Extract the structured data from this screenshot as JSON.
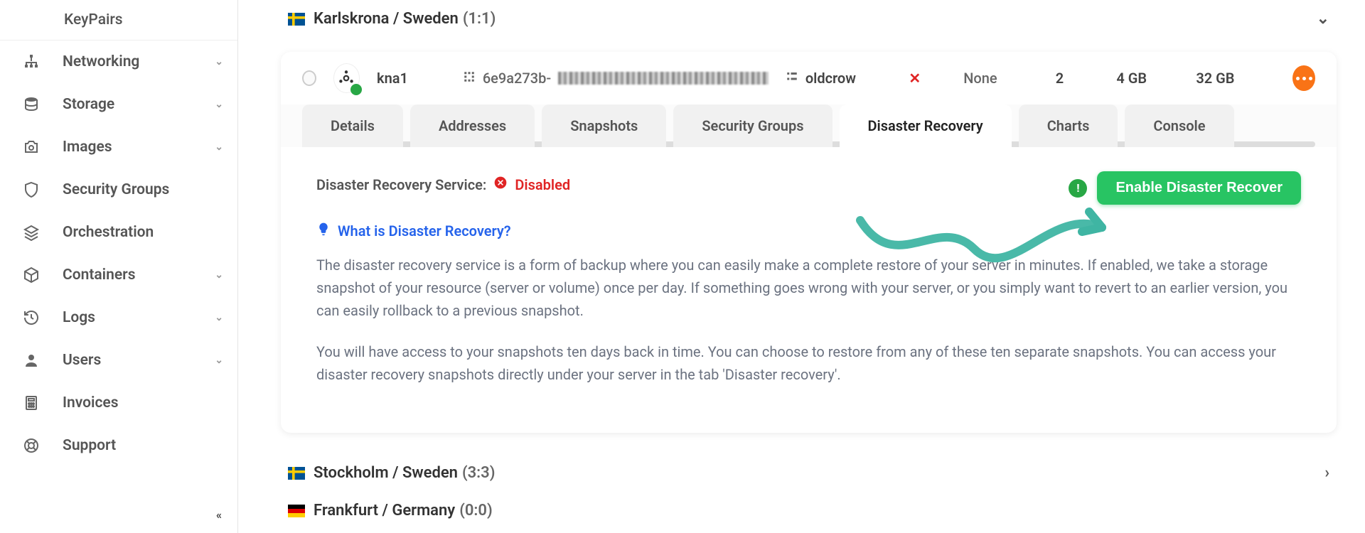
{
  "sidebar": {
    "items": [
      {
        "label": "KeyPairs",
        "chev": false,
        "sub": true
      },
      {
        "label": "Networking",
        "chev": true
      },
      {
        "label": "Storage",
        "chev": true
      },
      {
        "label": "Images",
        "chev": true
      },
      {
        "label": "Security Groups",
        "chev": false
      },
      {
        "label": "Orchestration",
        "chev": false
      },
      {
        "label": "Containers",
        "chev": true
      },
      {
        "label": "Logs",
        "chev": true
      },
      {
        "label": "Users",
        "chev": true
      },
      {
        "label": "Invoices",
        "chev": false
      },
      {
        "label": "Support",
        "chev": false
      }
    ]
  },
  "regions": {
    "r1": {
      "name": "Karlskrona / Sweden",
      "count": "(1:1)"
    },
    "r2": {
      "name": "Stockholm / Sweden",
      "count": "(3:3)"
    },
    "r3": {
      "name": "Frankfurt / Germany",
      "count": "(0:0)"
    }
  },
  "instance": {
    "name": "kna1",
    "uuid_prefix": "6e9a273b-",
    "host": "oldcrow",
    "ip": "None",
    "cpu": "2",
    "memory": "4 GB",
    "disk": "32 GB"
  },
  "tabs": {
    "t0": "Details",
    "t1": "Addresses",
    "t2": "Snapshots",
    "t3": "Security Groups",
    "t4": "Disaster Recovery",
    "t5": "Charts",
    "t6": "Console"
  },
  "dr": {
    "status_label": "Disaster Recovery Service:",
    "status_value": "Disabled",
    "enable_label": "Enable Disaster Recover",
    "what_heading": "What is Disaster Recovery?",
    "p1": "The disaster recovery service is a form of backup where you can easily make a complete restore of your server in minutes. If enabled, we take a storage snapshot of your resource (server or volume) once per day. If something goes wrong with your server, or you simply want to revert to an earlier version, you can easily rollback to a previous snapshot.",
    "p2": "You will have access to your snapshots ten days back in time. You can choose to restore from any of these ten separate snapshots. You can access your disaster recovery snapshots directly under your server in the tab 'Disaster recovery'."
  }
}
